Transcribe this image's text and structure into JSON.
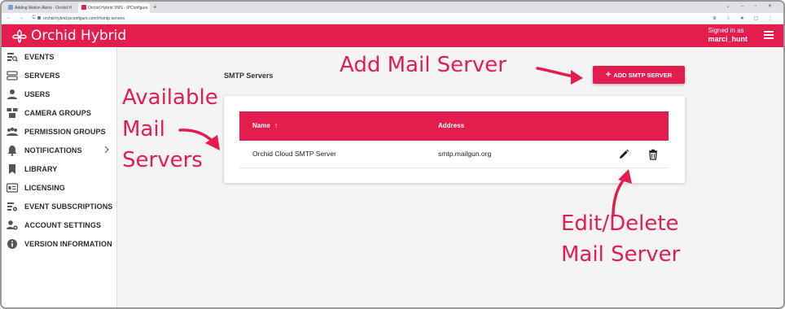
{
  "browser": {
    "tabs": [
      {
        "title": "Adding Motion Alerts - Orchid H"
      },
      {
        "title": "Orchid Hybrid VMS - IPConfigure"
      }
    ],
    "url": "orchid-hybrid.ipconfigure.com/#/smtp-servers"
  },
  "header": {
    "brand": "Orchid Hybrid",
    "signed_in_label": "Signed in as",
    "username": "marci_hunt"
  },
  "sidebar": {
    "items": [
      {
        "label": "EVENTS",
        "icon": "events-icon"
      },
      {
        "label": "SERVERS",
        "icon": "servers-icon"
      },
      {
        "label": "USERS",
        "icon": "user-icon"
      },
      {
        "label": "CAMERA GROUPS",
        "icon": "camera-groups-icon"
      },
      {
        "label": "PERMISSION GROUPS",
        "icon": "permission-groups-icon"
      },
      {
        "label": "NOTIFICATIONS",
        "icon": "bell-icon"
      },
      {
        "label": "LIBRARY",
        "icon": "bookmark-icon"
      },
      {
        "label": "LICENSING",
        "icon": "license-icon"
      },
      {
        "label": "EVENT SUBSCRIPTIONS",
        "icon": "event-subscriptions-icon"
      },
      {
        "label": "ACCOUNT SETTINGS",
        "icon": "account-settings-icon"
      },
      {
        "label": "VERSION INFORMATION",
        "icon": "info-icon"
      }
    ]
  },
  "main": {
    "section_title": "SMTP Servers",
    "add_button_label": "ADD SMTP SERVER",
    "table": {
      "columns": [
        {
          "label": "Name",
          "sort": "↑"
        },
        {
          "label": "Address"
        }
      ],
      "rows": [
        {
          "name": "Orchid Cloud SMTP Server",
          "address": "smtp.mailgun.org"
        }
      ]
    }
  },
  "annotations": {
    "add": "Add Mail Server",
    "available": [
      "Available",
      "Mail",
      "Servers"
    ],
    "edit_delete": [
      "Edit/Delete",
      "Mail Server"
    ]
  },
  "colors": {
    "accent": "#e31e4f",
    "sidebar_bg": "#ffffff",
    "content_bg": "#f4f4f4"
  }
}
